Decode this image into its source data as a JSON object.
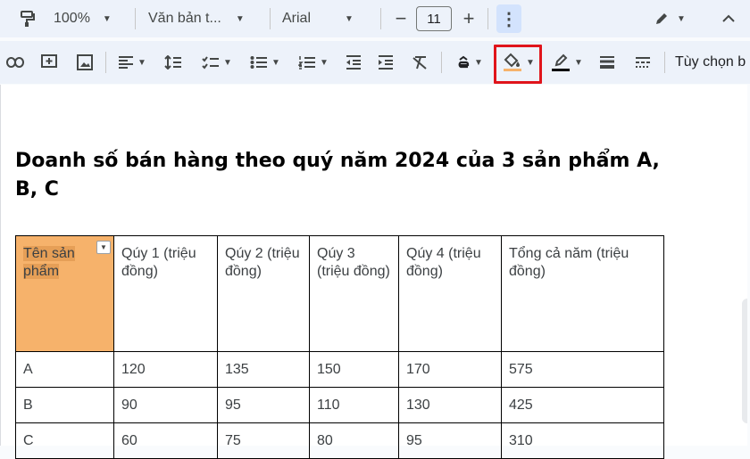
{
  "toolbar1": {
    "zoom": "100%",
    "style": "Văn bản t...",
    "font": "Arial",
    "font_size": "11",
    "minus": "−",
    "plus": "+",
    "more": "⋮"
  },
  "toolbar2": {
    "options_label": "Tùy chọn b",
    "text_color": "#000000",
    "fill_color": "#f6b26b"
  },
  "document": {
    "title": "Doanh số bán hàng theo quý năm 2024 của 3 sản phẩm A, B, C"
  },
  "table": {
    "headers": [
      "Tên sản phẩm",
      "Qúy 1 (triệu đồng)",
      "Qúy 2 (triệu đồng)",
      "Qúy 3 (triệu đồng)",
      "Qúy 4 (triệu đồng)",
      "Tổng cả năm (triệu đồng)"
    ],
    "rows": [
      [
        "A",
        "120",
        "135",
        "150",
        "170",
        "575"
      ],
      [
        "B",
        "90",
        "95",
        "110",
        "130",
        "425"
      ],
      [
        "C",
        "60",
        "75",
        "80",
        "95",
        "310"
      ]
    ]
  }
}
